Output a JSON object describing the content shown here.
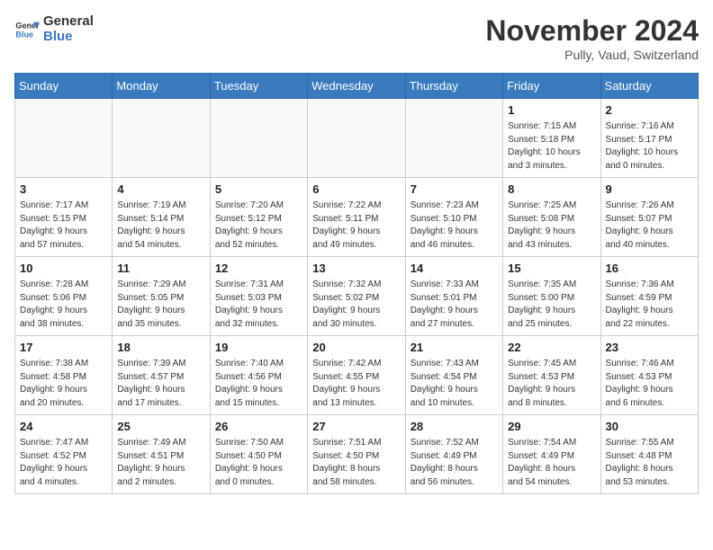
{
  "header": {
    "logo_line1": "General",
    "logo_line2": "Blue",
    "month": "November 2024",
    "location": "Pully, Vaud, Switzerland"
  },
  "weekdays": [
    "Sunday",
    "Monday",
    "Tuesday",
    "Wednesday",
    "Thursday",
    "Friday",
    "Saturday"
  ],
  "weeks": [
    [
      {
        "day": "",
        "info": ""
      },
      {
        "day": "",
        "info": ""
      },
      {
        "day": "",
        "info": ""
      },
      {
        "day": "",
        "info": ""
      },
      {
        "day": "",
        "info": ""
      },
      {
        "day": "1",
        "info": "Sunrise: 7:15 AM\nSunset: 5:18 PM\nDaylight: 10 hours\nand 3 minutes."
      },
      {
        "day": "2",
        "info": "Sunrise: 7:16 AM\nSunset: 5:17 PM\nDaylight: 10 hours\nand 0 minutes."
      }
    ],
    [
      {
        "day": "3",
        "info": "Sunrise: 7:17 AM\nSunset: 5:15 PM\nDaylight: 9 hours\nand 57 minutes."
      },
      {
        "day": "4",
        "info": "Sunrise: 7:19 AM\nSunset: 5:14 PM\nDaylight: 9 hours\nand 54 minutes."
      },
      {
        "day": "5",
        "info": "Sunrise: 7:20 AM\nSunset: 5:12 PM\nDaylight: 9 hours\nand 52 minutes."
      },
      {
        "day": "6",
        "info": "Sunrise: 7:22 AM\nSunset: 5:11 PM\nDaylight: 9 hours\nand 49 minutes."
      },
      {
        "day": "7",
        "info": "Sunrise: 7:23 AM\nSunset: 5:10 PM\nDaylight: 9 hours\nand 46 minutes."
      },
      {
        "day": "8",
        "info": "Sunrise: 7:25 AM\nSunset: 5:08 PM\nDaylight: 9 hours\nand 43 minutes."
      },
      {
        "day": "9",
        "info": "Sunrise: 7:26 AM\nSunset: 5:07 PM\nDaylight: 9 hours\nand 40 minutes."
      }
    ],
    [
      {
        "day": "10",
        "info": "Sunrise: 7:28 AM\nSunset: 5:06 PM\nDaylight: 9 hours\nand 38 minutes."
      },
      {
        "day": "11",
        "info": "Sunrise: 7:29 AM\nSunset: 5:05 PM\nDaylight: 9 hours\nand 35 minutes."
      },
      {
        "day": "12",
        "info": "Sunrise: 7:31 AM\nSunset: 5:03 PM\nDaylight: 9 hours\nand 32 minutes."
      },
      {
        "day": "13",
        "info": "Sunrise: 7:32 AM\nSunset: 5:02 PM\nDaylight: 9 hours\nand 30 minutes."
      },
      {
        "day": "14",
        "info": "Sunrise: 7:33 AM\nSunset: 5:01 PM\nDaylight: 9 hours\nand 27 minutes."
      },
      {
        "day": "15",
        "info": "Sunrise: 7:35 AM\nSunset: 5:00 PM\nDaylight: 9 hours\nand 25 minutes."
      },
      {
        "day": "16",
        "info": "Sunrise: 7:36 AM\nSunset: 4:59 PM\nDaylight: 9 hours\nand 22 minutes."
      }
    ],
    [
      {
        "day": "17",
        "info": "Sunrise: 7:38 AM\nSunset: 4:58 PM\nDaylight: 9 hours\nand 20 minutes."
      },
      {
        "day": "18",
        "info": "Sunrise: 7:39 AM\nSunset: 4:57 PM\nDaylight: 9 hours\nand 17 minutes."
      },
      {
        "day": "19",
        "info": "Sunrise: 7:40 AM\nSunset: 4:56 PM\nDaylight: 9 hours\nand 15 minutes."
      },
      {
        "day": "20",
        "info": "Sunrise: 7:42 AM\nSunset: 4:55 PM\nDaylight: 9 hours\nand 13 minutes."
      },
      {
        "day": "21",
        "info": "Sunrise: 7:43 AM\nSunset: 4:54 PM\nDaylight: 9 hours\nand 10 minutes."
      },
      {
        "day": "22",
        "info": "Sunrise: 7:45 AM\nSunset: 4:53 PM\nDaylight: 9 hours\nand 8 minutes."
      },
      {
        "day": "23",
        "info": "Sunrise: 7:46 AM\nSunset: 4:53 PM\nDaylight: 9 hours\nand 6 minutes."
      }
    ],
    [
      {
        "day": "24",
        "info": "Sunrise: 7:47 AM\nSunset: 4:52 PM\nDaylight: 9 hours\nand 4 minutes."
      },
      {
        "day": "25",
        "info": "Sunrise: 7:49 AM\nSunset: 4:51 PM\nDaylight: 9 hours\nand 2 minutes."
      },
      {
        "day": "26",
        "info": "Sunrise: 7:50 AM\nSunset: 4:50 PM\nDaylight: 9 hours\nand 0 minutes."
      },
      {
        "day": "27",
        "info": "Sunrise: 7:51 AM\nSunset: 4:50 PM\nDaylight: 8 hours\nand 58 minutes."
      },
      {
        "day": "28",
        "info": "Sunrise: 7:52 AM\nSunset: 4:49 PM\nDaylight: 8 hours\nand 56 minutes."
      },
      {
        "day": "29",
        "info": "Sunrise: 7:54 AM\nSunset: 4:49 PM\nDaylight: 8 hours\nand 54 minutes."
      },
      {
        "day": "30",
        "info": "Sunrise: 7:55 AM\nSunset: 4:48 PM\nDaylight: 8 hours\nand 53 minutes."
      }
    ]
  ]
}
